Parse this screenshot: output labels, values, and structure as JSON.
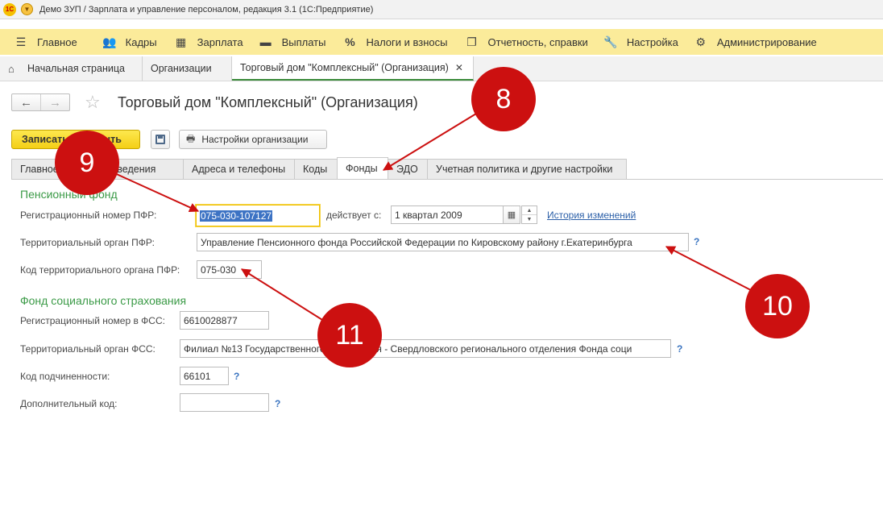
{
  "window": {
    "title": "Демо ЗУП / Зарплата и управление персоналом, редакция 3.1  (1С:Предприятие)"
  },
  "sections": [
    {
      "label": "Главное",
      "icon": "menu-icon"
    },
    {
      "label": "Кадры",
      "icon": "people-icon"
    },
    {
      "label": "Зарплата",
      "icon": "calculator-icon"
    },
    {
      "label": "Выплаты",
      "icon": "wallet-icon"
    },
    {
      "label": "Налоги и взносы",
      "icon": "percent-icon"
    },
    {
      "label": "Отчетность, справки",
      "icon": "documents-icon"
    },
    {
      "label": "Настройка",
      "icon": "wrench-icon"
    },
    {
      "label": "Администрирование",
      "icon": "gear-icon"
    }
  ],
  "open_tabs": [
    {
      "label": "Начальная страница",
      "icon": "home-icon"
    },
    {
      "label": "Организации"
    },
    {
      "label": "Торговый дом \"Комплексный\" (Организация)",
      "active": true
    }
  ],
  "form": {
    "title": "Торговый дом \"Комплексный\" (Организация)",
    "save_close_label": "Записать и закрыть",
    "settings_button_label": "Настройки организации",
    "tabs": [
      {
        "label": "Главное"
      },
      {
        "label": "Основные сведения"
      },
      {
        "label": "Адреса и телефоны"
      },
      {
        "label": "Коды"
      },
      {
        "label": "Фонды",
        "active": true
      },
      {
        "label": "ЭДО"
      },
      {
        "label": "Учетная политика и другие настройки"
      }
    ],
    "tabs_visible": [
      "Главное",
      "Основные сведения",
      "Адреса и телефоны",
      "Коды",
      "Фонды",
      "ЭДО",
      "Учетная политика и другие настройки"
    ],
    "pfr": {
      "group_title": "Пенсионный фонд",
      "reg_number_label": "Регистрационный номер ПФР:",
      "reg_number_value": "075-030-107127",
      "valid_from_label": "действует с:",
      "valid_from_value": "1 квартал 2009",
      "history_link": "История изменений",
      "territorial_label": "Территориальный орган ПФР:",
      "territorial_value": "Управление Пенсионного фонда Российской Федерации по Кировскому району г.Екатеринбурга",
      "territorial_code_label": "Код территориального органа ПФР:",
      "territorial_code_value": "075-030"
    },
    "fss": {
      "group_title": "Фонд социального страхования",
      "reg_number_label": "Регистрационный номер в ФСС:",
      "reg_number_value": "6610028877",
      "territorial_label": "Территориальный орган ФСС:",
      "territorial_value": "Филиал №13 Государственного учреждения - Свердловского регионального отделения Фонда соци",
      "subordination_label": "Код подчиненности:",
      "subordination_value": "66101",
      "additional_code_label": "Дополнительный код:",
      "additional_code_value": ""
    },
    "help_mark": "?"
  },
  "annotations": {
    "badges": [
      "8",
      "9",
      "10",
      "11"
    ],
    "color": "#cc1010"
  }
}
